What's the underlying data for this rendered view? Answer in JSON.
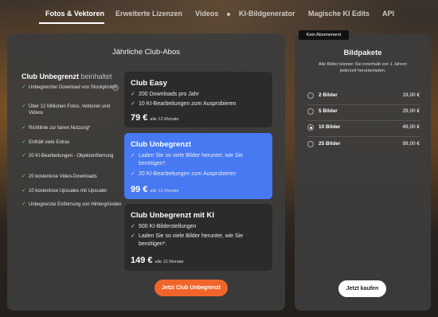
{
  "nav": {
    "tabs": [
      {
        "label": "Fotos & Vektoren"
      },
      {
        "label": "Erweiterte Lizenzen"
      },
      {
        "label": "Videos"
      },
      {
        "label": "KI-Bildgenerator"
      },
      {
        "label": "Magische KI Edits"
      },
      {
        "label": "API"
      }
    ]
  },
  "club": {
    "title": "Jährliche Club-Abos",
    "includes_bold": "Club Unbegrenzt",
    "includes_light": "beinhaltet",
    "features": [
      "Unbegrenzter Download von Stockphotos",
      "Über 12 Millionen Fotos, Vektoren und Videos",
      "Richtlinie zur fairen Nutzung*",
      "Enthält viele Extras",
      "20 KI-Bearbeitungen - Objektentfernung",
      "20 kostenlose Video-Downloads",
      "10 kostenlose Upscales mit Upscaler",
      "Unbegrenzte Entfernung von Hintergründen"
    ],
    "plans": [
      {
        "name": "Club Easy",
        "items": [
          "200 Downloads pro Jahr",
          "10 KI-Bearbeitungen zum Ausprobieren"
        ],
        "price": "79 €",
        "period": "alle 12 Monate"
      },
      {
        "name": "Club Unbegrenzt",
        "items": [
          "Laden Sie so viele Bilder herunter, wie Sie benötigen*.",
          "20 KI-Bearbeitungen zum Ausprobieren"
        ],
        "price": "99 €",
        "period": "alle 12 Monate"
      },
      {
        "name": "Club Unbegrenzt mit KI",
        "items": [
          "500 KI-Bilderstellungen",
          "Laden Sie so viele Bilder herunter, wie Sie benötigen*."
        ],
        "price": "149 €",
        "period": "alle 12 Monate"
      }
    ],
    "selected_plan": "Club Unbegrenzt",
    "cta": "Jetzt Club Unbegrenzt"
  },
  "packages": {
    "badge": "Kein Abonnement",
    "title": "Bildpakete",
    "subtitle": "Alle Bilder können Sie innerhalb von 1 Jahren jederzeit herunterladen.",
    "options": [
      {
        "label": "2 Bilder",
        "price": "19,00 €"
      },
      {
        "label": "5 Bilder",
        "price": "29,00 €"
      },
      {
        "label": "10 Bilder",
        "price": "49,00 €"
      },
      {
        "label": "25 Bilder",
        "price": "99,00 €"
      }
    ],
    "selected": "10 Bilder",
    "buy": "Jetzt kaufen"
  },
  "colors": {
    "accent_orange": "#f0662a",
    "selected_blue": "#4679f2",
    "check_green": "#5fd16a"
  }
}
